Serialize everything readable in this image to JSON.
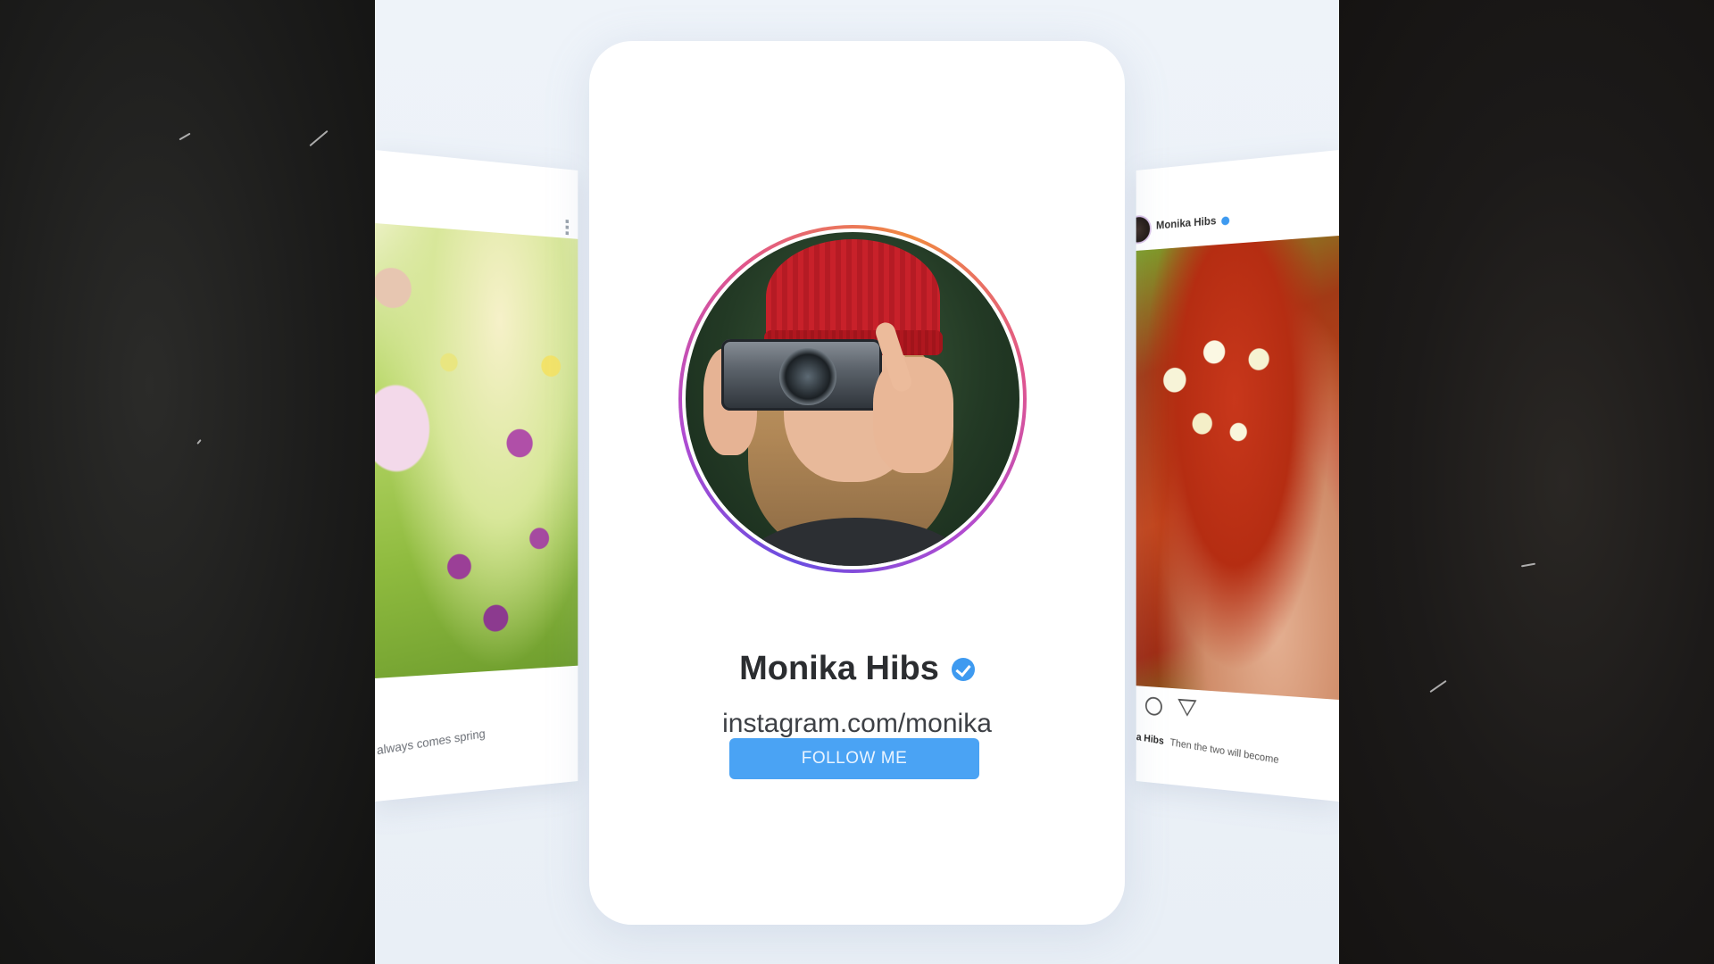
{
  "profile": {
    "name": "Monika Hibs",
    "link": "instagram.com/monika",
    "follow_button_label": "FOLLOW ME",
    "verified": true
  },
  "post_left": {
    "caption": "always comes spring"
  },
  "post_right": {
    "username": "Monika Hibs",
    "caption_user": "a Hibs",
    "caption_text": "Then the two will become"
  },
  "colors": {
    "accent_blue": "#4aa3f4",
    "verified_blue": "#3e9af0",
    "ring_gradient": [
      "#6a4de0",
      "#b24bd0",
      "#e1558c",
      "#f0893f"
    ]
  },
  "icons": {
    "verified": "verified-badge-icon",
    "comment": "comment-bubble-icon",
    "share": "send-icon",
    "more": "more-dots-icon"
  }
}
